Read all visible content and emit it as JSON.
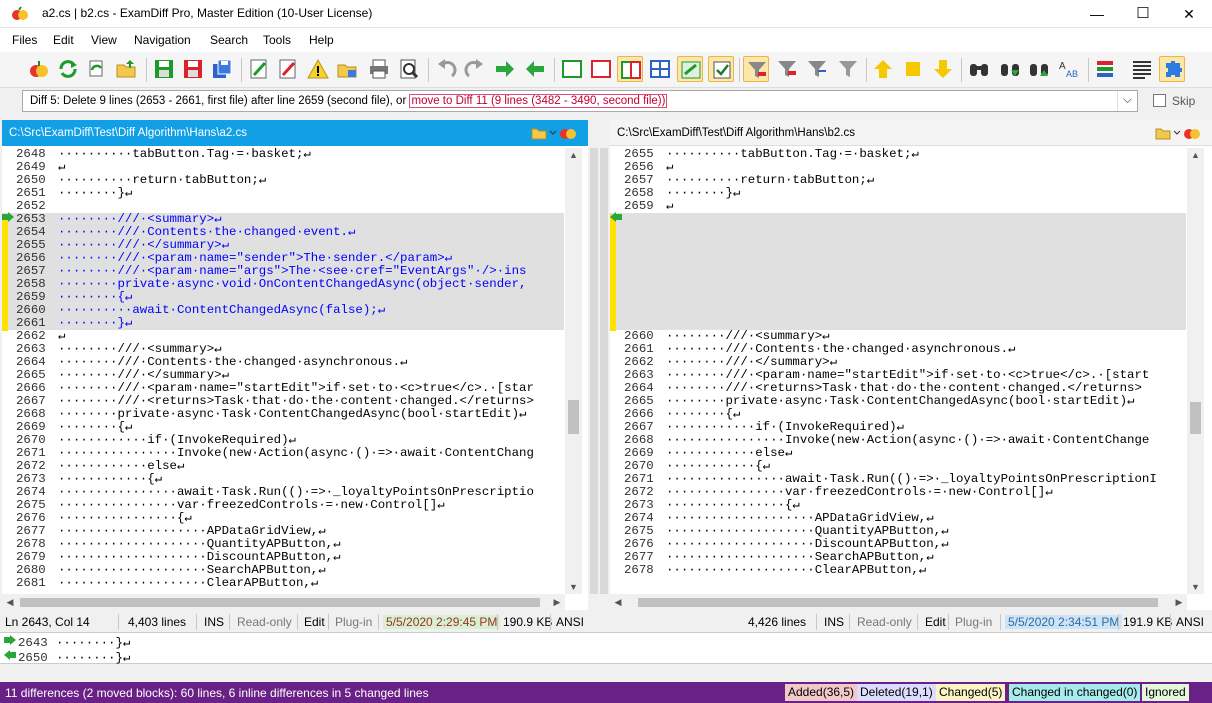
{
  "window": {
    "title": "a2.cs  |  b2.cs - ExamDiff Pro, Master Edition (10-User License)",
    "minimize": "—",
    "maximize": "☐",
    "close": "✕"
  },
  "menu": [
    "Files",
    "Edit",
    "View",
    "Navigation",
    "Search",
    "Tools",
    "Help"
  ],
  "toolbar": {
    "icons": [
      "open-files-icon",
      "recompare-icon",
      "sync-compare-icon",
      "open-folder-icon",
      "save-left-icon",
      "save-right-icon",
      "save-all-icon",
      "edit-left-icon",
      "edit-right-icon",
      "warning-icon",
      "folder-warning-icon",
      "print-icon",
      "print-preview-icon",
      "undo-icon",
      "redo-icon",
      "next-diff-icon",
      "prev-diff-icon",
      "view-left-icon",
      "view-right-icon",
      "split-view-icon",
      "grid-view-icon",
      "merge-icon",
      "check-icon",
      "filter-icon",
      "filter-left-icon",
      "filter-right-icon",
      "filter-all-icon",
      "up-icon",
      "current-icon",
      "down-icon",
      "find-icon",
      "find-next-icon",
      "find-prev-icon",
      "case-icon",
      "color-options-icon",
      "word-wrap-icon",
      "plugin-icon"
    ]
  },
  "diffbar": {
    "text": "Diff 5: Delete 9 lines (2653 - 2661, first file) after line 2659 (second file), or ",
    "link": "move to Diff 11 (9 lines (3482 - 3490, second file))",
    "dropdown_icon": "chevron-down-icon"
  },
  "skip": {
    "label": "Skip",
    "checked": false
  },
  "left_pane": {
    "path": "C:\\Src\\ExamDiff\\Test\\Diff Algorithm\\Hans\\a2.cs",
    "status": {
      "position": "Ln 2643, Col 14",
      "lines": "4,403 lines",
      "ins": "INS",
      "readonly": "Read-only",
      "edit": "Edit",
      "plugin": "Plug-in",
      "date": "5/5/2020 2:29:45 PM",
      "size": "190.9 KB",
      "enc": "ANSI"
    },
    "lines": [
      {
        "n": "2648",
        "kind": "normal",
        "t": "··········tabButton.Tag·=·basket;↵"
      },
      {
        "n": "2649",
        "kind": "normal",
        "t": "↵"
      },
      {
        "n": "2650",
        "kind": "normal",
        "t": "··········return·tabButton;↵"
      },
      {
        "n": "2651",
        "kind": "normal",
        "t": "········}↵"
      },
      {
        "n": "2652",
        "kind": "normal",
        "t": ""
      },
      {
        "n": "2653",
        "kind": "chg",
        "t": "········///·<summary>↵"
      },
      {
        "n": "2654",
        "kind": "chg",
        "t": "········///·Contents·the·changed·event.↵"
      },
      {
        "n": "2655",
        "kind": "chg",
        "t": "········///·</summary>↵"
      },
      {
        "n": "2656",
        "kind": "chg",
        "t": "········///·<param·name=\"sender\">The·sender.</param>↵"
      },
      {
        "n": "2657",
        "kind": "chg",
        "t": "········///·<param·name=\"args\">The·<see·cref=\"EventArgs\"·/>·ins"
      },
      {
        "n": "2658",
        "kind": "chg",
        "t": "········private·async·void·OnContentChangedAsync(object·sender,"
      },
      {
        "n": "2659",
        "kind": "chg",
        "t": "········{↵"
      },
      {
        "n": "2660",
        "kind": "chg",
        "t": "··········await·ContentChangedAsync(false);↵"
      },
      {
        "n": "2661",
        "kind": "chg",
        "t": "········}↵"
      },
      {
        "n": "2662",
        "kind": "normal",
        "t": "↵"
      },
      {
        "n": "2663",
        "kind": "normal",
        "t": "········///·<summary>↵"
      },
      {
        "n": "2664",
        "kind": "normal",
        "t": "········///·Contents·the·changed·asynchronous.↵"
      },
      {
        "n": "2665",
        "kind": "normal",
        "t": "········///·</summary>↵"
      },
      {
        "n": "2666",
        "kind": "normal",
        "t": "········///·<param·name=\"startEdit\">if·set·to·<c>true</c>.·[star"
      },
      {
        "n": "2667",
        "kind": "normal",
        "t": "········///·<returns>Task·that·do·the·content·changed.</returns>"
      },
      {
        "n": "2668",
        "kind": "normal",
        "t": "········private·async·Task·ContentChangedAsync(bool·startEdit)↵"
      },
      {
        "n": "2669",
        "kind": "normal",
        "t": "········{↵"
      },
      {
        "n": "2670",
        "kind": "normal",
        "t": "············if·(InvokeRequired)↵"
      },
      {
        "n": "2671",
        "kind": "normal",
        "t": "················Invoke(new·Action(async·()·=>·await·ContentChang"
      },
      {
        "n": "2672",
        "kind": "normal",
        "t": "············else↵"
      },
      {
        "n": "2673",
        "kind": "normal",
        "t": "············{↵"
      },
      {
        "n": "2674",
        "kind": "normal",
        "t": "················await·Task.Run(()·=>·_loyaltyPointsOnPrescriptio"
      },
      {
        "n": "2675",
        "kind": "normal",
        "t": "················var·freezedControls·=·new·Control[]↵"
      },
      {
        "n": "2676",
        "kind": "normal",
        "t": "················{↵"
      },
      {
        "n": "2677",
        "kind": "normal",
        "t": "····················APDataGridView,↵"
      },
      {
        "n": "2678",
        "kind": "normal",
        "t": "····················QuantityAPButton,↵"
      },
      {
        "n": "2679",
        "kind": "normal",
        "t": "····················DiscountAPButton,↵"
      },
      {
        "n": "2680",
        "kind": "normal",
        "t": "····················SearchAPButton,↵"
      },
      {
        "n": "2681",
        "kind": "normal",
        "t": "····················ClearAPButton,↵"
      }
    ]
  },
  "right_pane": {
    "path": "C:\\Src\\ExamDiff\\Test\\Diff Algorithm\\Hans\\b2.cs",
    "status": {
      "lines": "4,426 lines",
      "ins": "INS",
      "readonly": "Read-only",
      "edit": "Edit",
      "plugin": "Plug-in",
      "date": "5/5/2020 2:34:51 PM",
      "size": "191.9 KB",
      "enc": "ANSI"
    },
    "lines": [
      {
        "n": "2655",
        "kind": "normal",
        "t": "··········tabButton.Tag·=·basket;↵"
      },
      {
        "n": "2656",
        "kind": "normal",
        "t": "↵"
      },
      {
        "n": "2657",
        "kind": "normal",
        "t": "··········return·tabButton;↵"
      },
      {
        "n": "2658",
        "kind": "normal",
        "t": "········}↵"
      },
      {
        "n": "2659",
        "kind": "normal",
        "t": "↵"
      },
      {
        "n": "",
        "kind": "ghost",
        "t": ""
      },
      {
        "n": "",
        "kind": "ghost",
        "t": ""
      },
      {
        "n": "",
        "kind": "ghost",
        "t": ""
      },
      {
        "n": "",
        "kind": "ghost",
        "t": ""
      },
      {
        "n": "",
        "kind": "ghost",
        "t": ""
      },
      {
        "n": "",
        "kind": "ghost",
        "t": ""
      },
      {
        "n": "",
        "kind": "ghost",
        "t": ""
      },
      {
        "n": "",
        "kind": "ghost",
        "t": ""
      },
      {
        "n": "",
        "kind": "ghost",
        "t": ""
      },
      {
        "n": "2660",
        "kind": "normal",
        "t": "········///·<summary>↵"
      },
      {
        "n": "2661",
        "kind": "normal",
        "t": "········///·Contents·the·changed·asynchronous.↵"
      },
      {
        "n": "2662",
        "kind": "normal",
        "t": "········///·</summary>↵"
      },
      {
        "n": "2663",
        "kind": "normal",
        "t": "········///·<param·name=\"startEdit\">if·set·to·<c>true</c>.·[start"
      },
      {
        "n": "2664",
        "kind": "normal",
        "t": "········///·<returns>Task·that·do·the·content·changed.</returns>"
      },
      {
        "n": "2665",
        "kind": "normal",
        "t": "········private·async·Task·ContentChangedAsync(bool·startEdit)↵"
      },
      {
        "n": "2666",
        "kind": "normal",
        "t": "········{↵"
      },
      {
        "n": "2667",
        "kind": "normal",
        "t": "············if·(InvokeRequired)↵"
      },
      {
        "n": "2668",
        "kind": "normal",
        "t": "················Invoke(new·Action(async·()·=>·await·ContentChange"
      },
      {
        "n": "2669",
        "kind": "normal",
        "t": "············else↵"
      },
      {
        "n": "2670",
        "kind": "normal",
        "t": "············{↵"
      },
      {
        "n": "2671",
        "kind": "normal",
        "t": "················await·Task.Run(()·=>·_loyaltyPointsOnPrescriptionI"
      },
      {
        "n": "2672",
        "kind": "normal",
        "t": "················var·freezedControls·=·new·Control[]↵"
      },
      {
        "n": "2673",
        "kind": "normal",
        "t": "················{↵"
      },
      {
        "n": "2674",
        "kind": "normal",
        "t": "····················APDataGridView,↵"
      },
      {
        "n": "2675",
        "kind": "normal",
        "t": "····················QuantityAPButton,↵"
      },
      {
        "n": "2676",
        "kind": "normal",
        "t": "····················DiscountAPButton,↵"
      },
      {
        "n": "2677",
        "kind": "normal",
        "t": "····················SearchAPButton,↵"
      },
      {
        "n": "2678",
        "kind": "normal",
        "t": "····················ClearAPButton,↵"
      }
    ]
  },
  "mini": [
    {
      "n": "2643",
      "t": "········}↵"
    },
    {
      "n": "2650",
      "t": "········}↵"
    }
  ],
  "summary": "11 differences (2 moved blocks): 60 lines, 6 inline differences in 5 changed lines",
  "badges": [
    {
      "label": "Added(36,5)",
      "bg": "#f3c8c8"
    },
    {
      "label": "Deleted(19,1)",
      "bg": "#dcdcff"
    },
    {
      "label": "Changed(5)",
      "bg": "#fbf3c4"
    },
    {
      "label": "Changed in changed(0)",
      "bg": "#a6ecec"
    },
    {
      "label": "Ignored",
      "bg": "#e4f7dc"
    }
  ],
  "colors": {
    "accent": "#11a0e6",
    "diff_marker": "#ffe200",
    "status_bar": "#6a2187",
    "left_date_bg": "#d7f0d0",
    "right_date_bg": "#cfe3f7"
  }
}
